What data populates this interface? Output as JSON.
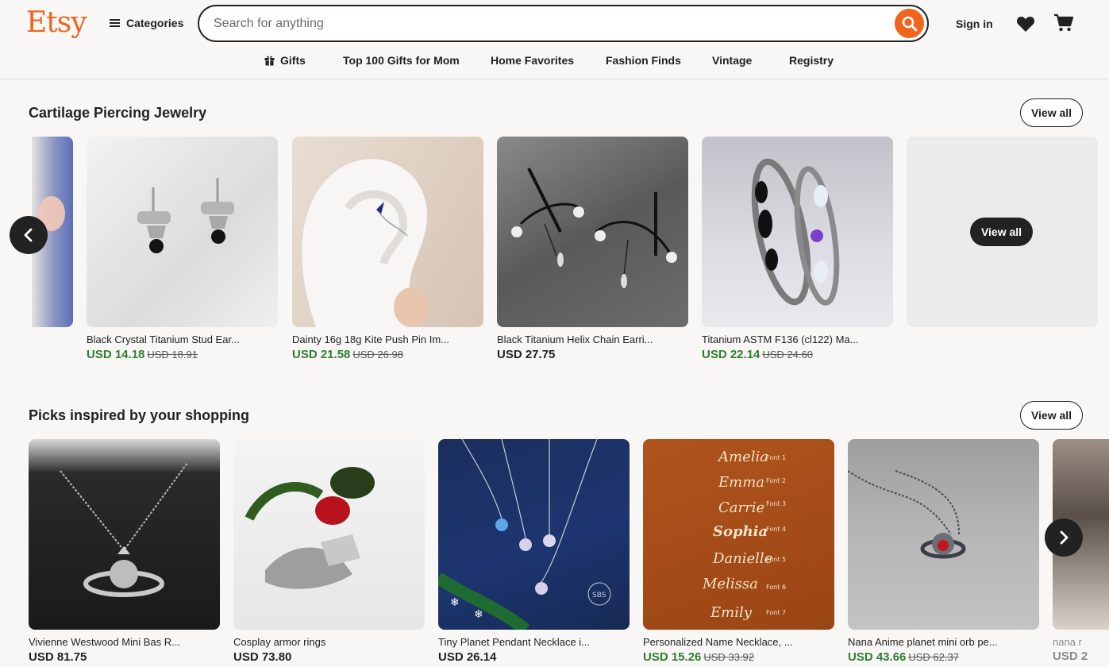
{
  "header": {
    "logo": "Etsy",
    "categories_label": "Categories",
    "search_placeholder": "Search for anything",
    "signin_label": "Sign in",
    "accent_color": "#f1641e"
  },
  "subnav": {
    "items": [
      "Gifts",
      "Top 100 Gifts for Mom",
      "Home Favorites",
      "Fashion Finds",
      "Vintage",
      "Registry"
    ]
  },
  "section1": {
    "title": "Cartilage Piercing Jewelry",
    "view_all": "View all",
    "tile_view_all": "View all",
    "items": [
      {
        "title": "Black Crystal Titanium Stud Ear...",
        "price": "USD 14.18",
        "original": "USD 18.91",
        "on_sale": true
      },
      {
        "title": "Dainty 16g 18g Kite Push Pin Im...",
        "price": "USD 21.58",
        "original": "USD 26.98",
        "on_sale": true
      },
      {
        "title": "Black Titanium Helix Chain Earri...",
        "price": "USD 27.75",
        "original": "",
        "on_sale": false
      },
      {
        "title": "Titanium ASTM F136 (cl122) Ma...",
        "price": "USD 22.14",
        "original": "USD 24.60",
        "on_sale": true
      }
    ]
  },
  "section2": {
    "title": "Picks inspired by your shopping",
    "view_all": "View all",
    "items": [
      {
        "title": "Vivienne Westwood Mini Bas R...",
        "price": "USD 81.75",
        "original": "",
        "on_sale": false
      },
      {
        "title": "Cosplay armor rings",
        "price": "USD 73.80",
        "original": "",
        "on_sale": false
      },
      {
        "title": "Tiny Planet Pendant Necklace i...",
        "price": "USD 26.14",
        "original": "",
        "on_sale": false
      },
      {
        "title": "Personalized Name Necklace, ...",
        "price": "USD 15.26",
        "original": "USD 33.92",
        "on_sale": true
      },
      {
        "title": "Nana Anime planet mini orb pe...",
        "price": "USD 43.66",
        "original": "USD 62.37",
        "on_sale": true
      }
    ],
    "partial_title": "nana r",
    "partial_price": "USD 2",
    "name_necklace_names": [
      "Amelia",
      "Emma",
      "Carrie",
      "Sophia",
      "Danielle",
      "Melissa",
      "Emily"
    ],
    "name_necklace_fonts": [
      "Font 1",
      "Font 2",
      "Font 3",
      "Font 4",
      "Font 5",
      "Font 6",
      "Font 7"
    ],
    "planet_watermark": "SBS"
  }
}
